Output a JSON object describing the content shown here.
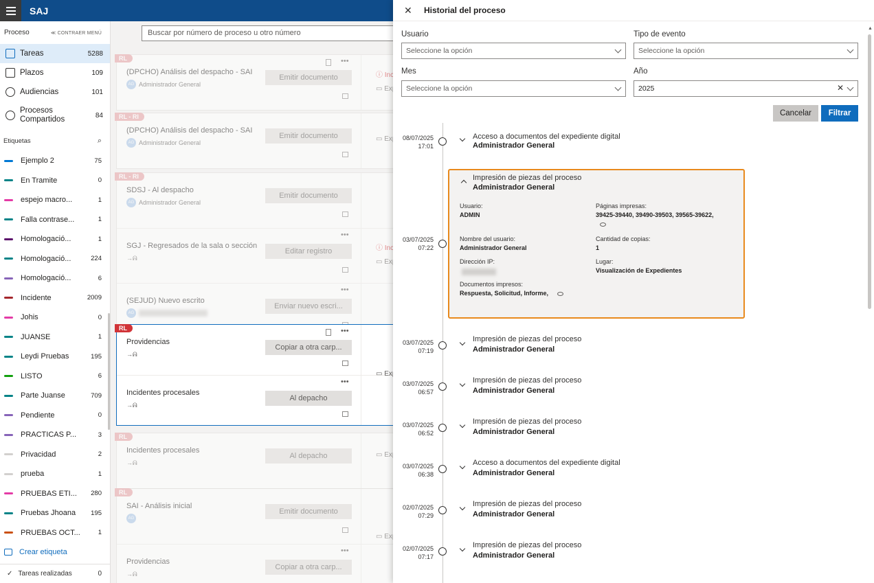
{
  "app": {
    "title": "SAJ"
  },
  "sidebar": {
    "section_title": "Proceso",
    "collapse_label": "≪ CONTRAER MENÚ",
    "nav": [
      {
        "label": "Tareas",
        "count": "5288",
        "icon": "tasks-icon"
      },
      {
        "label": "Plazos",
        "count": "109",
        "icon": "calendar-icon"
      },
      {
        "label": "Audiencias",
        "count": "101",
        "icon": "people-icon"
      },
      {
        "label": "Procesos Compartidos",
        "count": "84",
        "icon": "share-icon"
      }
    ],
    "tags_title": "Etiquetas",
    "tags": [
      {
        "label": "Ejemplo 2",
        "count": "75",
        "color": "#0078d4"
      },
      {
        "label": "En Tramite",
        "count": "0",
        "color": "#038387"
      },
      {
        "label": "espejo macro...",
        "count": "1",
        "color": "#e43ba6"
      },
      {
        "label": "Falla contrase...",
        "count": "1",
        "color": "#038387"
      },
      {
        "label": "Homologació...",
        "count": "1",
        "color": "#5c126b"
      },
      {
        "label": "Homologació...",
        "count": "224",
        "color": "#038387"
      },
      {
        "label": "Homologació...",
        "count": "6",
        "color": "#8764b8"
      },
      {
        "label": "Incidente",
        "count": "2009",
        "color": "#a4262c"
      },
      {
        "label": "Johis",
        "count": "0",
        "color": "#e43ba6"
      },
      {
        "label": "JUANSE",
        "count": "1",
        "color": "#038387"
      },
      {
        "label": "Leydi Pruebas",
        "count": "195",
        "color": "#038387"
      },
      {
        "label": "LISTO",
        "count": "6",
        "color": "#13a10e"
      },
      {
        "label": "Parte Juanse",
        "count": "709",
        "color": "#038387"
      },
      {
        "label": "Pendiente",
        "count": "0",
        "color": "#8764b8"
      },
      {
        "label": "PRACTICAS P...",
        "count": "3",
        "color": "#8764b8"
      },
      {
        "label": "Privacidad",
        "count": "2",
        "color": "#d2d0ce"
      },
      {
        "label": "prueba",
        "count": "1",
        "color": "#d2d0ce"
      },
      {
        "label": "PRUEBAS ETI...",
        "count": "280",
        "color": "#e43ba6"
      },
      {
        "label": "Pruebas Jhoana",
        "count": "195",
        "color": "#038387"
      },
      {
        "label": "PRUEBAS OCT...",
        "count": "1",
        "color": "#ca5010"
      }
    ],
    "create_tag": "Crear etiqueta",
    "done_label": "Tareas realizadas",
    "done_count": "0"
  },
  "content": {
    "search_placeholder": "Buscar por número de proceso u otro número",
    "cards": [
      {
        "badge": "RL",
        "tasks": [
          {
            "title": "(DPCHO) Análisis del despacho - SAI",
            "user": "Administrador General",
            "button": "Emitir documento"
          }
        ]
      },
      {
        "badge": "RL - RI",
        "tasks": [
          {
            "title": "(DPCHO) Análisis del despacho - SAI",
            "user": "Administrador General",
            "button": "Emitir documento"
          }
        ]
      },
      {
        "badge": "RL - RI",
        "tasks": [
          {
            "title": "SDSJ - Al despacho",
            "user": "Administrador General",
            "button": "Emitir documento"
          },
          {
            "title": "SGJ - Regresados de la sala o sección",
            "user": "",
            "button": "Editar registro"
          },
          {
            "title": "(SEJUD) Nuevo escrito",
            "user": "",
            "button": "Enviar nuevo escri..."
          }
        ]
      },
      {
        "badge": "RL",
        "tasks": [
          {
            "title": "Providencias",
            "user": "",
            "button": "Copiar a otra carp..."
          },
          {
            "title": "Incidentes procesales",
            "user": "",
            "button": "Al depacho"
          }
        ]
      },
      {
        "badge": "RL",
        "tasks": [
          {
            "title": "Incidentes procesales",
            "user": "",
            "button": "Al depacho"
          }
        ]
      },
      {
        "badge": "RL",
        "tasks": [
          {
            "title": "SAI - Análisis inicial",
            "user": "",
            "button": "Emitir documento"
          },
          {
            "title": "Providencias",
            "user": "",
            "button": "Copiar a otra carp..."
          }
        ]
      }
    ],
    "side_labels": {
      "inc": "Inc",
      "exp": "Exp"
    }
  },
  "panel": {
    "title": "Historial del proceso",
    "filters": {
      "usuario": {
        "label": "Usuario",
        "placeholder": "Seleccione la opción"
      },
      "tipo": {
        "label": "Tipo de evento",
        "placeholder": "Seleccione la opción"
      },
      "mes": {
        "label": "Mes",
        "placeholder": "Seleccione la opción"
      },
      "anio": {
        "label": "Año",
        "value": "2025"
      }
    },
    "cancel": "Cancelar",
    "filter": "Filtrar",
    "events": [
      {
        "date": "08/07/2025",
        "time": "17:01",
        "title": "Acceso a documentos del expediente digital",
        "user": "Administrador General"
      },
      {
        "date": "03/07/2025",
        "time": "07:22",
        "title": "Impresión de piezas del proceso",
        "user": "Administrador General"
      },
      {
        "date": "03/07/2025",
        "time": "07:19",
        "title": "Impresión de piezas del proceso",
        "user": "Administrador General"
      },
      {
        "date": "03/07/2025",
        "time": "06:57",
        "title": "Impresión de piezas del proceso",
        "user": "Administrador General"
      },
      {
        "date": "03/07/2025",
        "time": "06:52",
        "title": "Impresión de piezas del proceso",
        "user": "Administrador General"
      },
      {
        "date": "03/07/2025",
        "time": "06:38",
        "title": "Acceso a documentos del expediente digital",
        "user": "Administrador General"
      },
      {
        "date": "02/07/2025",
        "time": "07:29",
        "title": "Impresión de piezas del proceso",
        "user": "Administrador General"
      },
      {
        "date": "02/07/2025",
        "time": "07:17",
        "title": "Impresión de piezas del proceso",
        "user": "Administrador General"
      }
    ],
    "detail": {
      "usuario_k": "Usuario:",
      "usuario_v": "ADMIN",
      "paginas_k": "Páginas impresas:",
      "paginas_v": "39425-39440,  39490-39503,  39565-39622,",
      "nombre_k": "Nombre del usuario:",
      "nombre_v": "Administrador General",
      "copias_k": "Cantidad de copias:",
      "copias_v": "1",
      "ip_k": "Dirección IP:",
      "lugar_k": "Lugar:",
      "lugar_v": "Visualización de Expedientes",
      "docs_k": "Documentos impresos:",
      "docs_v": "Respuesta,  Solicitud,  Informe,"
    }
  }
}
